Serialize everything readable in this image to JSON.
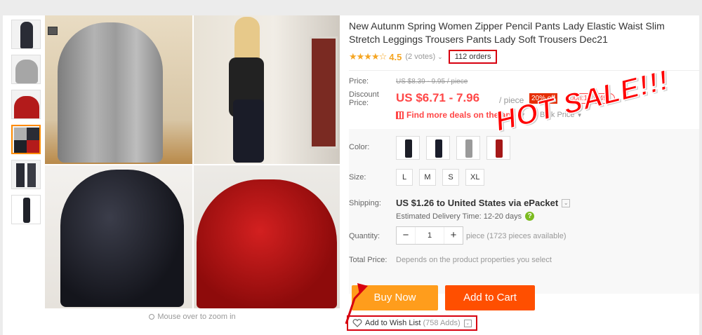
{
  "product": {
    "title": "New Autunm Spring Women Zipper Pencil Pants Lady Elastic Waist Slim Stretch Leggings Trousers Pants Lady Soft Trousers Dec21",
    "rating_stars": "★★★★☆",
    "rating_value": "4.5",
    "votes": "(2 votes)",
    "orders": "112 orders"
  },
  "price": {
    "price_label": "Price:",
    "original": "US $8.39 - 9.95 / piece",
    "discount_label": "Discount Price:",
    "discount": "US $6.71 - 7.96",
    "per_piece": "/ piece",
    "off_badge": "20% off",
    "timer": "00h:12m:49s",
    "deals_link": "Find more deals on the app",
    "bulk_price": "Bulk Price"
  },
  "options": {
    "color_label": "Color:",
    "colors": [
      "#1c1e27",
      "#1a1d2b",
      "#9a9a9a",
      "#a51818"
    ],
    "size_label": "Size:",
    "sizes": [
      "L",
      "M",
      "S",
      "XL"
    ]
  },
  "shipping": {
    "label": "Shipping:",
    "value": "US $1.26 to United States via ePacket",
    "estimated": "Estimated Delivery Time: 12-20 days"
  },
  "quantity": {
    "label": "Quantity:",
    "value": "1",
    "available": "piece (1723 pieces available)"
  },
  "total": {
    "label": "Total Price:",
    "value": "Depends on the product properties you select"
  },
  "actions": {
    "buy_now": "Buy Now",
    "add_to_cart": "Add to Cart",
    "wish_list": "Add to Wish List",
    "wish_adds": "(758 Adds)"
  },
  "gallery": {
    "zoom_hint": "Mouse over to zoom in"
  },
  "promo": {
    "hot_sale": "HOT SALE!!!"
  }
}
